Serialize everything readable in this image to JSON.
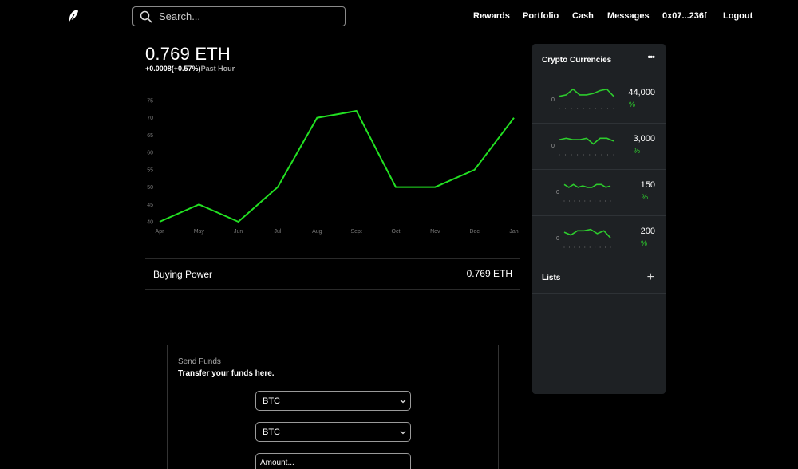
{
  "header": {
    "logo_icon": "feather-icon",
    "search": {
      "placeholder": "Search..."
    },
    "nav": {
      "rewards": "Rewards",
      "portfolio": "Portfolio",
      "cash": "Cash",
      "messages": "Messages",
      "account": "0x07...236f",
      "logout": "Logout"
    }
  },
  "balance": {
    "value": "0.769 ETH",
    "change": "+0.0008(+0.57%)",
    "period": "Past Hour"
  },
  "chart_data": {
    "type": "line",
    "categories": [
      "Apr",
      "May",
      "Jun",
      "Jul",
      "Aug",
      "Sept",
      "Oct",
      "Nov",
      "Dec",
      "Jan"
    ],
    "values": [
      40,
      45,
      40,
      50,
      70,
      72,
      50,
      50,
      55,
      70
    ],
    "yticks": [
      40,
      45,
      50,
      55,
      60,
      65,
      70,
      75
    ],
    "ylim": [
      40,
      75
    ],
    "line_color": "#22e022",
    "grid": false
  },
  "buying_power": {
    "label": "Buying Power",
    "value": "0.769 ETH"
  },
  "send_funds": {
    "title": "Send Funds",
    "subtitle": "Transfer your funds here.",
    "from_currency": "BTC",
    "to_currency": "BTC",
    "amount_placeholder": "Amount..."
  },
  "sidebar": {
    "title": "Crypto Currencies",
    "more_icon": "ellipsis-icon",
    "rows": [
      {
        "price": "44,000",
        "pct": "%",
        "axis_label": "0",
        "spark": [
          3,
          4,
          8,
          4,
          4,
          5,
          7,
          8,
          3
        ]
      },
      {
        "price": "3,000",
        "pct": "%",
        "axis_label": "0",
        "spark": [
          5,
          6,
          5,
          5,
          6,
          2,
          6,
          6,
          4
        ]
      },
      {
        "price": "150",
        "pct": "%",
        "axis_label": "0",
        "spark": [
          6,
          4,
          6,
          4,
          5,
          4,
          4,
          6,
          6,
          4,
          5
        ]
      },
      {
        "price": "200",
        "pct": "%",
        "axis_label": "0",
        "spark": [
          5,
          3,
          6,
          6,
          7,
          4,
          6,
          1
        ]
      }
    ],
    "lists_label": "Lists",
    "add_icon": "plus-icon",
    "accent": "#2dcc2d"
  }
}
